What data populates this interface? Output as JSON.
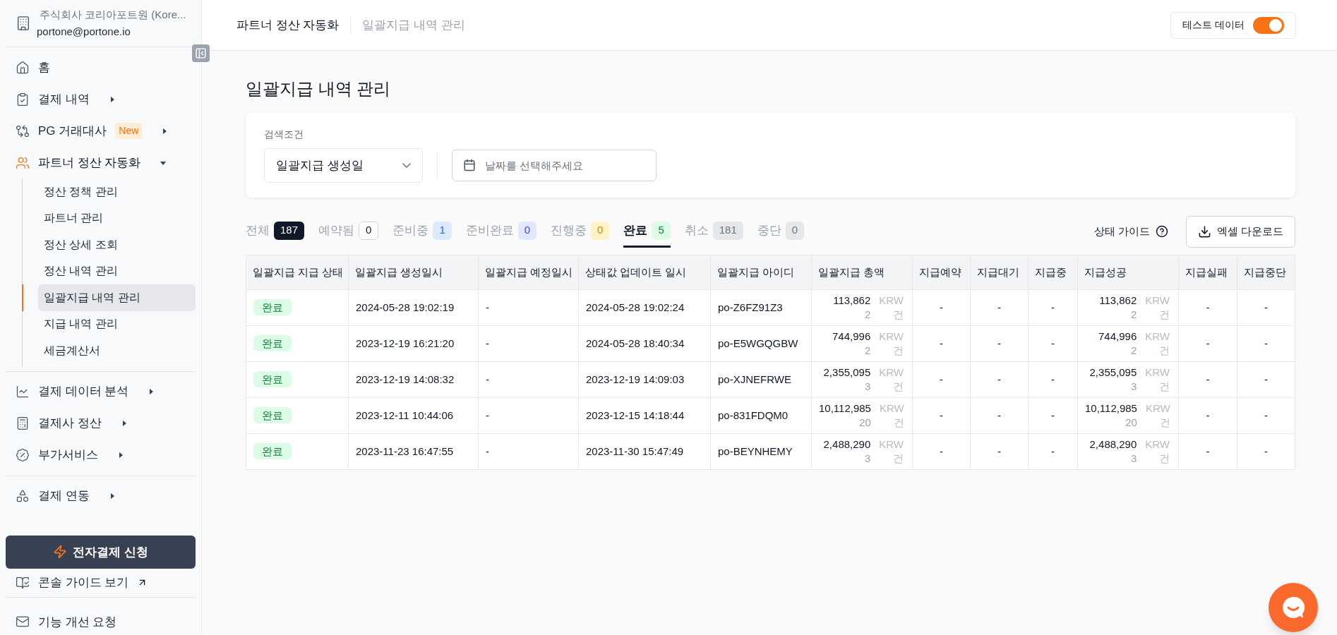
{
  "account": {
    "company": "주식회사 코리아포트원 (Kore...",
    "email": "portone@portone.io"
  },
  "sidebar": {
    "groups": [
      {
        "items": [
          {
            "label": "홈"
          },
          {
            "label": "결제 내역",
            "expanded": false
          },
          {
            "label": "PG 거래대사",
            "badge": "New",
            "expanded": false
          },
          {
            "label": "파트너 정산 자동화",
            "expanded": true,
            "active": true,
            "children": [
              {
                "label": "정산 정책 관리",
                "selected": false
              },
              {
                "label": "파트너 관리",
                "selected": false
              },
              {
                "label": "정산 상세 조회",
                "selected": false
              },
              {
                "label": "정산 내역 관리",
                "selected": false
              },
              {
                "label": "일괄지급 내역 관리",
                "selected": true
              },
              {
                "label": "지급 내역 관리",
                "selected": false
              },
              {
                "label": "세금계산서",
                "selected": false
              }
            ]
          }
        ]
      },
      {
        "items": [
          {
            "label": "결제 데이터 분석",
            "expanded": false
          },
          {
            "label": "결제사 정산",
            "expanded": false
          },
          {
            "label": "부가서비스",
            "expanded": false
          }
        ]
      },
      {
        "items": [
          {
            "label": "결제 연동",
            "expanded": false
          }
        ]
      }
    ],
    "apply_button": "전자결제 신청",
    "guide_link": "콘솔 가이드 보기",
    "feedback": "기능 개선 요청"
  },
  "breadcrumb": [
    "파트너 정산 자동화",
    "일괄지급 내역 관리"
  ],
  "test_data": {
    "label": "테스트 데이터",
    "on": true
  },
  "page_title": "일괄지급 내역 관리",
  "search": {
    "label": "검색조건",
    "select_value": "일괄지급 생성일",
    "date_placeholder": "날짜를 선택해주세요"
  },
  "tabs": [
    {
      "label": "전체",
      "count": "187",
      "kind": "dark",
      "selected": false
    },
    {
      "label": "예약됨",
      "count": "0",
      "kind": "outline",
      "selected": false
    },
    {
      "label": "준비중",
      "count": "1",
      "kind": "blue",
      "selected": false
    },
    {
      "label": "준비완료",
      "count": "0",
      "kind": "indigo",
      "selected": false
    },
    {
      "label": "진행중",
      "count": "0",
      "kind": "yellow",
      "selected": false
    },
    {
      "label": "완료",
      "count": "5",
      "kind": "green",
      "selected": true
    },
    {
      "label": "취소",
      "count": "181",
      "kind": "gray",
      "selected": false
    },
    {
      "label": "중단",
      "count": "0",
      "kind": "gray",
      "selected": false
    }
  ],
  "status_guide": "상태 가이드",
  "download_button": "엑셀 다운로드",
  "table": {
    "columns": [
      "일괄지급 지급 상태",
      "일괄지급 생성일시",
      "일괄지급 예정일시",
      "상태값 업데이트 일시",
      "일괄지급 아이디",
      "일괄지급 총액",
      "지급예약",
      "지급대기",
      "지급중",
      "지급성공",
      "지급실패",
      "지급중단"
    ],
    "rows": [
      {
        "status": "완료",
        "created": "2024-05-28 19:02:19",
        "scheduled": "-",
        "updated": "2024-05-28 19:02:24",
        "id": "po-Z6FZ91Z3",
        "total": {
          "amount": "113,862",
          "currency": "KRW",
          "count": "2",
          "unit": "건"
        },
        "reserved": "-",
        "waiting": "-",
        "in_progress": "-",
        "success": {
          "amount": "113,862",
          "currency": "KRW",
          "count": "2",
          "unit": "건"
        },
        "failed": "-",
        "stopped": "-"
      },
      {
        "status": "완료",
        "created": "2023-12-19 16:21:20",
        "scheduled": "-",
        "updated": "2024-05-28 18:40:34",
        "id": "po-E5WGQGBW",
        "total": {
          "amount": "744,996",
          "currency": "KRW",
          "count": "2",
          "unit": "건"
        },
        "reserved": "-",
        "waiting": "-",
        "in_progress": "-",
        "success": {
          "amount": "744,996",
          "currency": "KRW",
          "count": "2",
          "unit": "건"
        },
        "failed": "-",
        "stopped": "-"
      },
      {
        "status": "완료",
        "created": "2023-12-19 14:08:32",
        "scheduled": "-",
        "updated": "2023-12-19 14:09:03",
        "id": "po-XJNEFRWE",
        "total": {
          "amount": "2,355,095",
          "currency": "KRW",
          "count": "3",
          "unit": "건"
        },
        "reserved": "-",
        "waiting": "-",
        "in_progress": "-",
        "success": {
          "amount": "2,355,095",
          "currency": "KRW",
          "count": "3",
          "unit": "건"
        },
        "failed": "-",
        "stopped": "-"
      },
      {
        "status": "완료",
        "created": "2023-12-11 10:44:06",
        "scheduled": "-",
        "updated": "2023-12-15 14:18:44",
        "id": "po-831FDQM0",
        "total": {
          "amount": "10,112,985",
          "currency": "KRW",
          "count": "20",
          "unit": "건"
        },
        "reserved": "-",
        "waiting": "-",
        "in_progress": "-",
        "success": {
          "amount": "10,112,985",
          "currency": "KRW",
          "count": "20",
          "unit": "건"
        },
        "failed": "-",
        "stopped": "-"
      },
      {
        "status": "완료",
        "created": "2023-11-23 16:47:55",
        "scheduled": "-",
        "updated": "2023-11-30 15:47:49",
        "id": "po-BEYNHEMY",
        "total": {
          "amount": "2,488,290",
          "currency": "KRW",
          "count": "3",
          "unit": "건"
        },
        "reserved": "-",
        "waiting": "-",
        "in_progress": "-",
        "success": {
          "amount": "2,488,290",
          "currency": "KRW",
          "count": "3",
          "unit": "건"
        },
        "failed": "-",
        "stopped": "-"
      }
    ]
  }
}
